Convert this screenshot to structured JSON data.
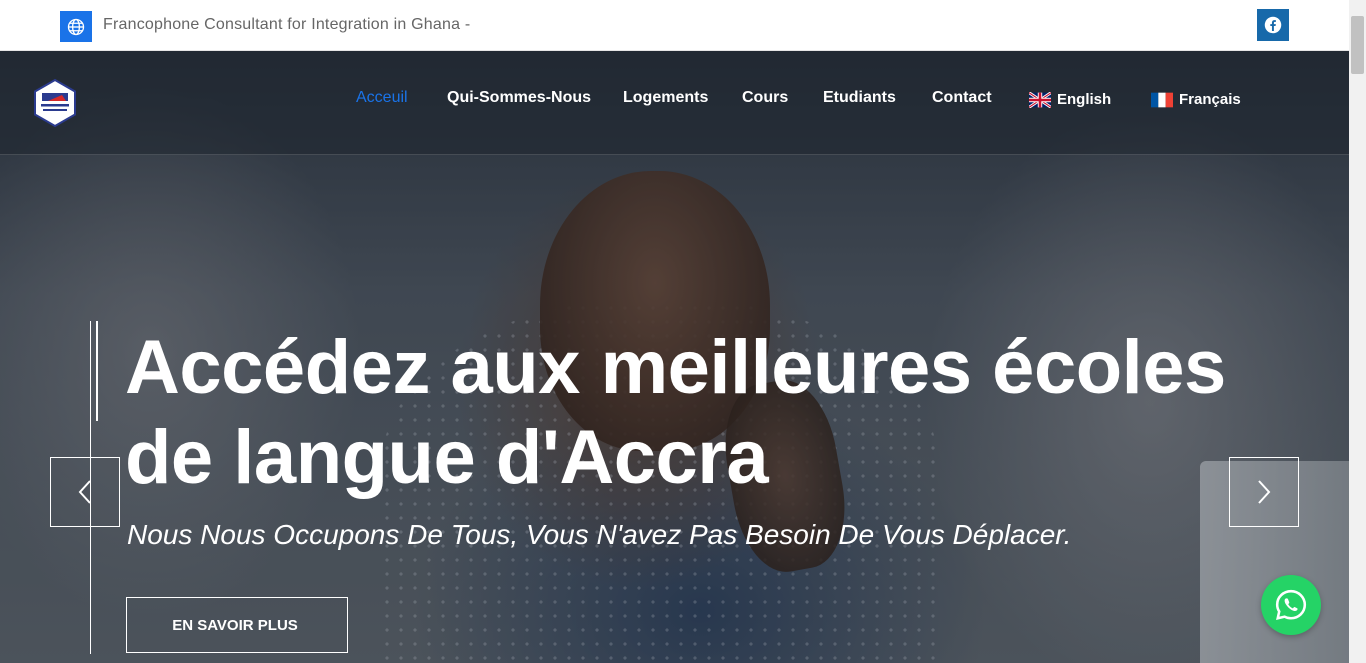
{
  "topbar": {
    "tagline": "Francophone Consultant for Integration in Ghana -",
    "globe_icon": "globe-icon",
    "facebook_icon": "facebook-icon",
    "accent_color": "#1a73e8"
  },
  "nav": {
    "logo_icon": "company-logo",
    "items": [
      {
        "label": "Acceuil",
        "active": true
      },
      {
        "label": "Qui-Sommes-Nous",
        "active": false
      },
      {
        "label": "Logements",
        "active": false
      },
      {
        "label": "Cours",
        "active": false
      },
      {
        "label": "Etudiants",
        "active": false
      },
      {
        "label": "Contact",
        "active": false
      }
    ],
    "languages": [
      {
        "label": "English",
        "flag": "uk-flag-icon"
      },
      {
        "label": "Français",
        "flag": "france-flag-icon"
      }
    ]
  },
  "hero": {
    "headline": "Accédez aux meilleures écoles de langue d'Accra",
    "subheadline": "Nous Nous Occupons De Tous, Vous N'avez Pas Besoin De Vous Déplacer.",
    "cta_label": "EN SAVOIR PLUS",
    "prev_icon": "chevron-left-icon",
    "next_icon": "chevron-right-icon"
  },
  "whatsapp": {
    "icon": "whatsapp-icon",
    "color": "#25d366"
  }
}
